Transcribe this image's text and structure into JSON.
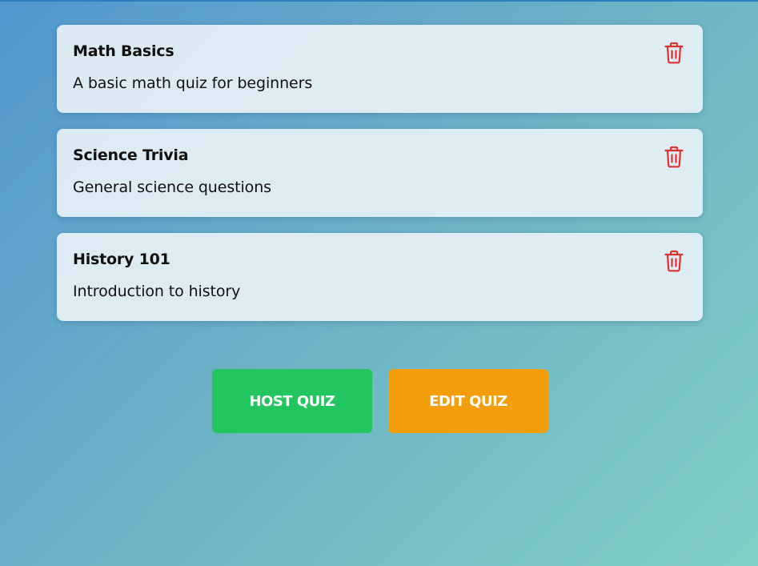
{
  "colors": {
    "card_background": "#e6f0f6",
    "delete_icon": "#e03131",
    "host_button": "#22c55e",
    "edit_button": "#f59e0b"
  },
  "quizzes": [
    {
      "title": "Math Basics",
      "description": "A basic math quiz for beginners",
      "delete_icon": "trash-icon"
    },
    {
      "title": "Science Trivia",
      "description": "General science questions",
      "delete_icon": "trash-icon"
    },
    {
      "title": "History 101",
      "description": "Introduction to history",
      "delete_icon": "trash-icon"
    }
  ],
  "actions": {
    "host_label": "HOST QUIZ",
    "edit_label": "EDIT QUIZ"
  }
}
